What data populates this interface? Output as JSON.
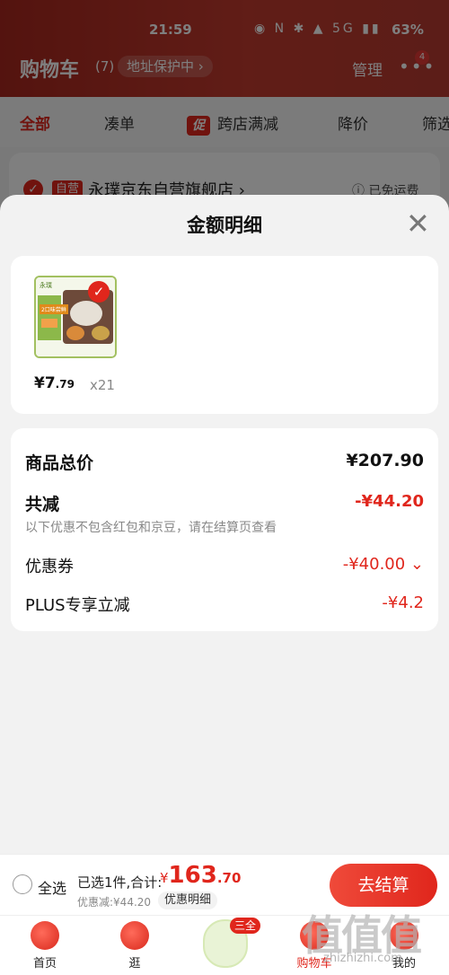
{
  "status_bar": {
    "time": "21:59",
    "icons": "◉ N ✱ ▲ 5G ▮▮",
    "battery": "63%"
  },
  "header": {
    "title": "购物车",
    "count": "(7)",
    "address_protect": "地址保护中 ›",
    "manage": "管理",
    "more_badge": "4"
  },
  "tabs": [
    {
      "label": "全部"
    },
    {
      "label": "凑单"
    },
    {
      "label": "跨店满减",
      "icon": "促"
    },
    {
      "label": "降价"
    },
    {
      "label": "筛选"
    }
  ],
  "store": {
    "tag": "自营",
    "name": "永璞京东自营旗舰店 ›",
    "shipping": "ⓘ 已免运费"
  },
  "sheet": {
    "title": "金额明细",
    "close_icon": "close-icon"
  },
  "product": {
    "brand": "永璞",
    "mini_label": "2口味尝鲜",
    "price_int": "¥7",
    "price_dec": ".79",
    "qty": "x21"
  },
  "summary": {
    "total_label": "商品总价",
    "total_value": "¥207.90",
    "reduce_label": "共减",
    "reduce_value": "-¥44.20",
    "note": "以下优惠不包含红包和京豆，请在结算页查看",
    "coupon_label": "优惠券",
    "coupon_value": "-¥40.00 ⌄",
    "plus_label": "PLUS专享立减",
    "plus_value": "-¥4.2"
  },
  "bottom_bar": {
    "select_all": "全选",
    "selected": "已选1件,合计:",
    "price_symbol": "¥",
    "price_int": "163",
    "price_dec": ".70",
    "discount": "优惠减:¥44.20",
    "discount_detail": "优惠明细",
    "checkout": "去结算"
  },
  "nav": {
    "items": [
      {
        "label": "首页"
      },
      {
        "label": "逛"
      },
      {
        "label": "购物车"
      },
      {
        "label": "我的"
      }
    ],
    "promo_badge": "三全"
  },
  "watermark": {
    "text": "值值值",
    "url": "zhizhizhi.com"
  },
  "colors": {
    "accent": "#e0261c",
    "header": "#b8322a"
  }
}
